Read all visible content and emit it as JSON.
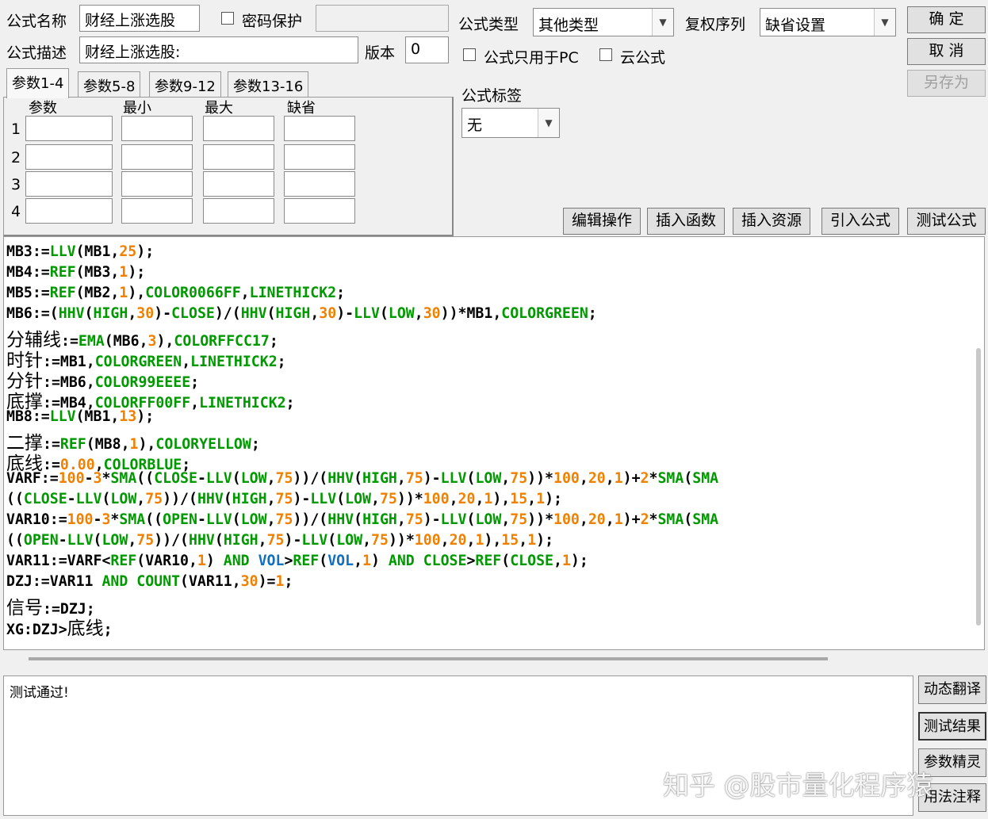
{
  "header": {
    "formula_name_label": "公式名称",
    "formula_name_value": "财经上涨选股",
    "password_label": "密码保护",
    "formula_desc_label": "公式描述",
    "formula_desc_value": "财经上涨选股:",
    "version_label": "版本",
    "version_value": "0",
    "formula_type_label": "公式类型",
    "formula_type_value": "其他类型",
    "restore_label": "复权序列",
    "restore_value": "缺省设置",
    "pc_only_label": "公式只用于PC",
    "cloud_label": "云公式",
    "tag_label": "公式标签",
    "tag_value": "无"
  },
  "buttons": {
    "ok": "确 定",
    "cancel": "取 消",
    "save_as": "另存为",
    "edit_ops": "编辑操作",
    "insert_func": "插入函数",
    "insert_res": "插入资源",
    "import_formula": "引入公式",
    "test_formula": "测试公式",
    "dynamic_translate": "动态翻译",
    "test_result": "测试结果",
    "param_wizard": "参数精灵",
    "usage_notes": "用法注释"
  },
  "params": {
    "tabs": [
      "参数1-4",
      "参数5-8",
      "参数9-12",
      "参数13-16"
    ],
    "columns": [
      "参数",
      "最小",
      "最大",
      "缺省"
    ],
    "rows": [
      "1",
      "2",
      "3",
      "4"
    ]
  },
  "code": {
    "l1": [
      "MB3:=",
      "LLV",
      "(MB1,",
      "25",
      ");"
    ],
    "l2": [
      "MB4:=",
      "REF",
      "(MB3,",
      "1",
      ");"
    ],
    "l3": [
      "MB5:=",
      "REF",
      "(MB2,",
      "1",
      "),",
      "COLOR0066FF",
      ",",
      "LINETHICK2",
      ";"
    ],
    "l4": [
      "MB6:=(",
      "HHV",
      "(",
      "HIGH",
      ",",
      "30",
      ")-",
      "CLOSE",
      ")/(",
      "HHV",
      "(",
      "HIGH",
      ",",
      "30",
      ")-",
      "LLV",
      "(",
      "LOW",
      ",",
      "30",
      "))*MB1,",
      "COLORGREEN",
      ";"
    ],
    "l5": [
      "分辅线",
      ":=",
      "EMA",
      "(MB6,",
      "3",
      "),",
      "COLORFFCC17",
      ";"
    ],
    "l6": [
      "时针",
      ":=MB1,",
      "COLORGREEN",
      ",",
      "LINETHICK2",
      ";"
    ],
    "l7": [
      "分针",
      ":=MB6,",
      "COLOR99EEEE",
      ";"
    ],
    "l8": [
      "底撑",
      ":=MB4,",
      "COLORFF00FF",
      ",",
      "LINETHICK2",
      ";"
    ],
    "l9": [
      "MB8:=",
      "LLV",
      "(MB1,",
      "13",
      ");"
    ],
    "l10": [
      "二撑",
      ":=",
      "REF",
      "(MB8,",
      "1",
      "),",
      "COLORYELLOW",
      ";"
    ],
    "l11": [
      "底线",
      ":=",
      "0.00",
      ",",
      "COLORBLUE",
      ";"
    ],
    "l12": [
      "VARF:=",
      "100",
      "-",
      "3",
      "*",
      "SMA",
      "((",
      "CLOSE",
      "-",
      "LLV",
      "(",
      "LOW",
      ",",
      "75",
      "))/(",
      "HHV",
      "(",
      "HIGH",
      ",",
      "75",
      ")-",
      "LLV",
      "(",
      "LOW",
      ",",
      "75",
      "))*",
      "100",
      ",",
      "20",
      ",",
      "1",
      ")+",
      "2",
      "*",
      "SMA",
      "(",
      "SMA"
    ],
    "l13": [
      "((",
      "CLOSE",
      "-",
      "LLV",
      "(",
      "LOW",
      ",",
      "75",
      "))/(",
      "HHV",
      "(",
      "HIGH",
      ",",
      "75",
      ")-",
      "LLV",
      "(",
      "LOW",
      ",",
      "75",
      "))*",
      "100",
      ",",
      "20",
      ",",
      "1",
      "),",
      "15",
      ",",
      "1",
      ");"
    ],
    "l14": [
      "VAR10:=",
      "100",
      "-",
      "3",
      "*",
      "SMA",
      "((",
      "OPEN",
      "-",
      "LLV",
      "(",
      "LOW",
      ",",
      "75",
      "))/(",
      "HHV",
      "(",
      "HIGH",
      ",",
      "75",
      ")-",
      "LLV",
      "(",
      "LOW",
      ",",
      "75",
      "))*",
      "100",
      ",",
      "20",
      ",",
      "1",
      ")+",
      "2",
      "*",
      "SMA",
      "(",
      "SMA"
    ],
    "l15": [
      "((",
      "OPEN",
      "-",
      "LLV",
      "(",
      "LOW",
      ",",
      "75",
      "))/(",
      "HHV",
      "(",
      "HIGH",
      ",",
      "75",
      ")-",
      "LLV",
      "(",
      "LOW",
      ",",
      "75",
      "))*",
      "100",
      ",",
      "20",
      ",",
      "1",
      "),",
      "15",
      ",",
      "1",
      ");"
    ],
    "l16": [
      "VAR11:=VARF<",
      "REF",
      "(VAR10,",
      "1",
      ") ",
      "AND",
      " ",
      "VOL",
      ">",
      "REF",
      "(",
      "VOL",
      ",",
      "1",
      ") ",
      "AND",
      " ",
      "CLOSE",
      ">",
      "REF",
      "(",
      "CLOSE",
      ",",
      "1",
      ");"
    ],
    "l17": [
      "DZJ:=VAR11 ",
      "AND",
      " ",
      "COUNT",
      "(VAR11,",
      "30",
      ")=",
      "1",
      ";"
    ],
    "l18": [
      "信号",
      ":=DZJ;"
    ],
    "l19": [
      "XG:DZJ>",
      "底线",
      ";"
    ]
  },
  "output": {
    "text": "测试通过!"
  },
  "watermark": "知乎 @股市量化程序猿"
}
